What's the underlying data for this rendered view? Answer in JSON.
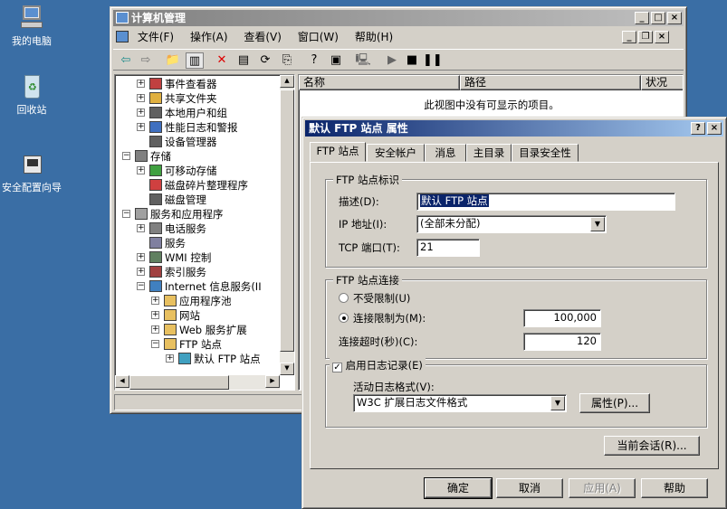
{
  "desktop": {
    "icons": [
      {
        "label": "我的电脑"
      },
      {
        "label": "回收站"
      },
      {
        "label": "安全配置向导"
      }
    ]
  },
  "mmc": {
    "title": "计算机管理",
    "menu": [
      "文件(F)",
      "操作(A)",
      "查看(V)",
      "窗口(W)",
      "帮助(H)"
    ],
    "tree": [
      {
        "label": "事件查看器"
      },
      {
        "label": "共享文件夹"
      },
      {
        "label": "本地用户和组"
      },
      {
        "label": "性能日志和警报"
      },
      {
        "label": "设备管理器"
      },
      {
        "label": "存储"
      },
      {
        "label": "可移动存储"
      },
      {
        "label": "磁盘碎片整理程序"
      },
      {
        "label": "磁盘管理"
      },
      {
        "label": "服务和应用程序"
      },
      {
        "label": "电话服务"
      },
      {
        "label": "服务"
      },
      {
        "label": "WMI 控制"
      },
      {
        "label": "索引服务"
      },
      {
        "label": "Internet 信息服务(II"
      },
      {
        "label": "应用程序池"
      },
      {
        "label": "网站"
      },
      {
        "label": "Web 服务扩展"
      },
      {
        "label": "FTP 站点"
      },
      {
        "label": "默认 FTP 站点"
      }
    ],
    "list": {
      "columns": [
        "名称",
        "路径",
        "状况"
      ],
      "empty_text": "此视图中没有可显示的项目。"
    }
  },
  "dialog": {
    "title": "默认 FTP 站点 属性",
    "tabs": [
      "FTP 站点",
      "安全帐户",
      "消息",
      "主目录",
      "目录安全性"
    ],
    "identity": {
      "legend": "FTP 站点标识",
      "desc_label": "描述(D):",
      "desc_value": "默认 FTP 站点",
      "ip_label": "IP 地址(I):",
      "ip_value": "(全部未分配)",
      "port_label": "TCP 端口(T):",
      "port_value": "21"
    },
    "connection": {
      "legend": "FTP 站点连接",
      "unlimited_label": "不受限制(U)",
      "limited_label": "连接限制为(M):",
      "limited_value": "100,000",
      "timeout_label": "连接超时(秒)(C):",
      "timeout_value": "120"
    },
    "logging": {
      "enable_label": "启用日志记录(E)",
      "format_label": "活动日志格式(V):",
      "format_value": "W3C 扩展日志文件格式",
      "properties_button": "属性(P)..."
    },
    "sessions_button": "当前会话(R)...",
    "buttons": {
      "ok": "确定",
      "cancel": "取消",
      "apply": "应用(A)",
      "help": "帮助"
    }
  }
}
